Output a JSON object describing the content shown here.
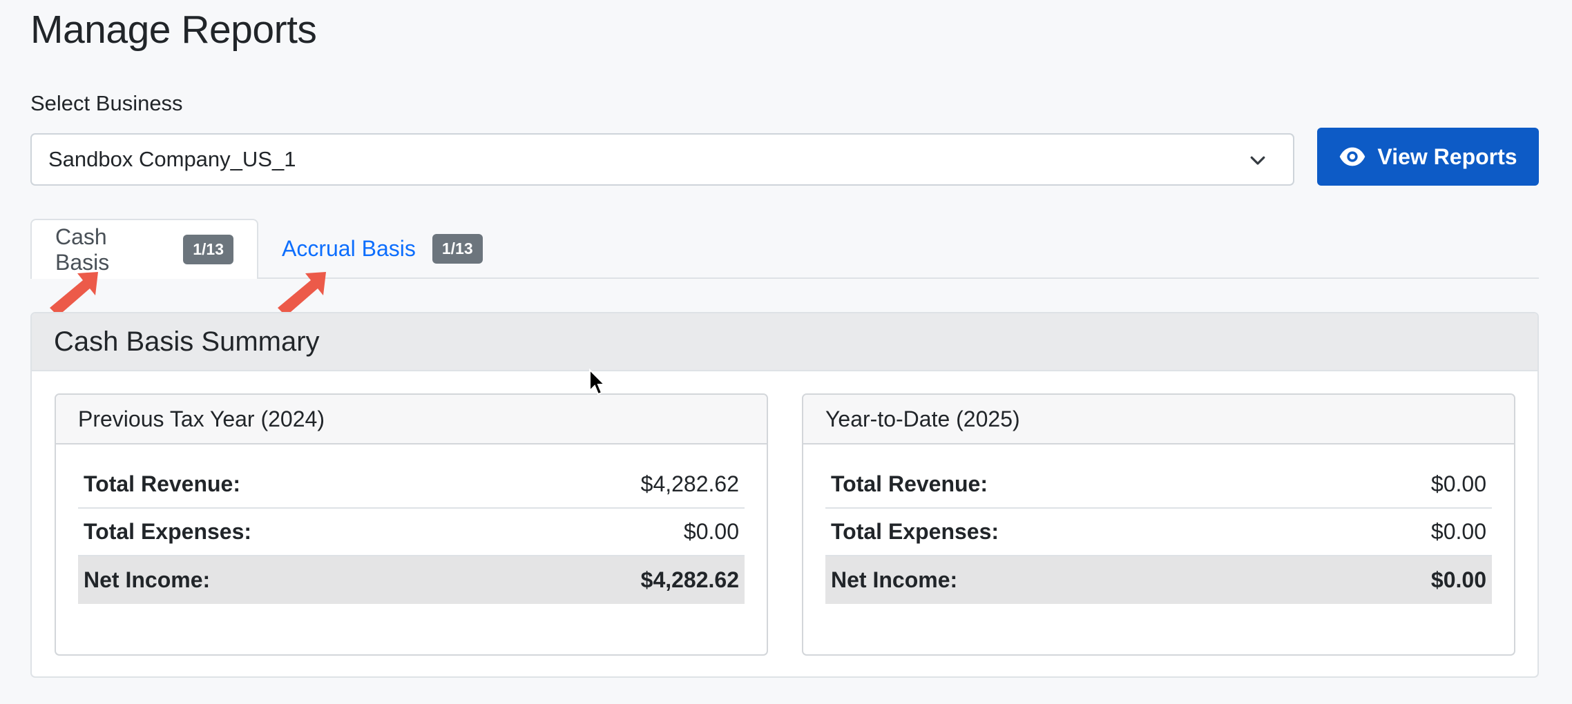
{
  "page": {
    "title": "Manage Reports"
  },
  "business_select": {
    "label": "Select Business",
    "value": "Sandbox Company_US_1"
  },
  "view_button": {
    "label": "View Reports",
    "icon": "eye-icon"
  },
  "tabs": [
    {
      "label": "Cash Basis",
      "badge": "1/13",
      "active": true
    },
    {
      "label": "Accrual Basis",
      "badge": "1/13",
      "active": false
    }
  ],
  "summary": {
    "title": "Cash Basis Summary",
    "periods": [
      {
        "title": "Previous Tax Year (2024)",
        "rows": [
          {
            "label": "Total Revenue:",
            "value": "$4,282.62"
          },
          {
            "label": "Total Expenses:",
            "value": "$0.00"
          },
          {
            "label": "Net Income:",
            "value": "$4,282.62"
          }
        ]
      },
      {
        "title": "Year-to-Date (2025)",
        "rows": [
          {
            "label": "Total Revenue:",
            "value": "$0.00"
          },
          {
            "label": "Total Expenses:",
            "value": "$0.00"
          },
          {
            "label": "Net Income:",
            "value": "$0.00"
          }
        ]
      }
    ]
  },
  "colors": {
    "primary": "#0d5bc6",
    "link": "#0d6efd",
    "badge": "#6c757d",
    "annotation_arrow": "#ec5a49"
  }
}
